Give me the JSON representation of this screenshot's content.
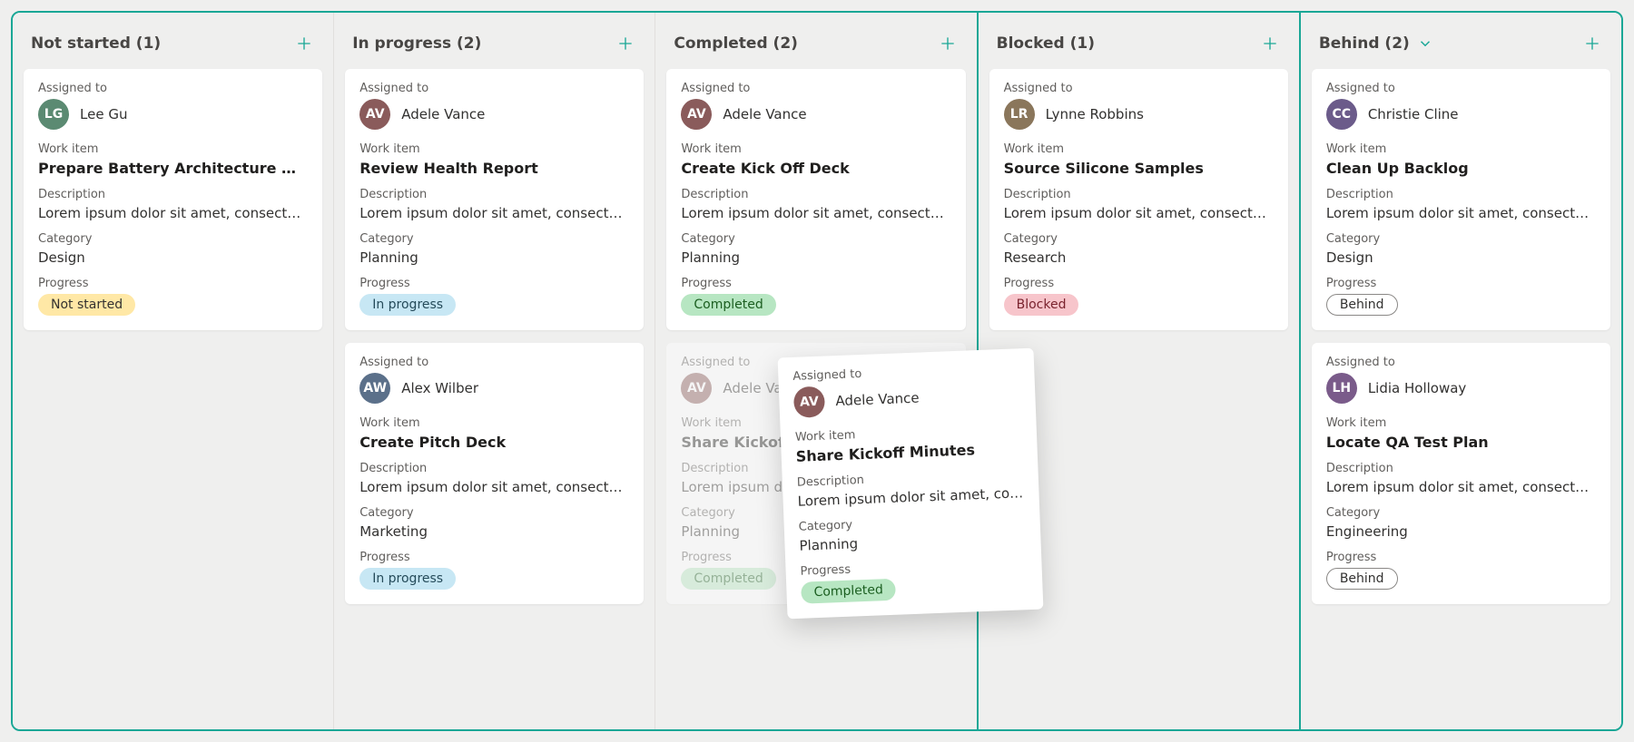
{
  "labels": {
    "assigned_to": "Assigned to",
    "work_item": "Work item",
    "description": "Description",
    "category": "Category",
    "progress": "Progress"
  },
  "columns": [
    {
      "title": "Not started (1)",
      "accent_divider": false,
      "show_chevron": false,
      "cards": [
        {
          "assignee": "Lee Gu",
          "assignee_initials": "LG",
          "avatar_class": "av-a",
          "work_item": "Prepare Battery Architecture Diag…",
          "description": "Lorem ipsum dolor sit amet, consecte…",
          "category": "Design",
          "progress_label": "Not started",
          "chip_class": "chip-notstarted",
          "ghost": false
        }
      ]
    },
    {
      "title": "In progress (2)",
      "accent_divider": false,
      "show_chevron": false,
      "cards": [
        {
          "assignee": "Adele Vance",
          "assignee_initials": "AV",
          "avatar_class": "av-b",
          "work_item": "Review Health Report",
          "description": "Lorem ipsum dolor sit amet, consecte…",
          "category": "Planning",
          "progress_label": "In progress",
          "chip_class": "chip-inprogress",
          "ghost": false
        },
        {
          "assignee": "Alex Wilber",
          "assignee_initials": "AW",
          "avatar_class": "av-e",
          "work_item": "Create Pitch Deck",
          "description": "Lorem ipsum dolor sit amet, consecte…",
          "category": "Marketing",
          "progress_label": "In progress",
          "chip_class": "chip-inprogress",
          "ghost": false
        }
      ]
    },
    {
      "title": "Completed (2)",
      "accent_divider": true,
      "show_chevron": false,
      "cards": [
        {
          "assignee": "Adele Vance",
          "assignee_initials": "AV",
          "avatar_class": "av-b",
          "work_item": "Create Kick Off Deck",
          "description": "Lorem ipsum dolor sit amet, consecte…",
          "category": "Planning",
          "progress_label": "Completed",
          "chip_class": "chip-completed",
          "ghost": false
        },
        {
          "assignee": "Adele Vance",
          "assignee_initials": "AV",
          "avatar_class": "av-b",
          "work_item": "Share Kickoff Minutes",
          "description": "Lorem ipsum dolor sit amet, consecte…",
          "category": "Planning",
          "progress_label": "Completed",
          "chip_class": "chip-completed",
          "ghost": true
        }
      ]
    },
    {
      "title": "Blocked (1)",
      "accent_divider": true,
      "show_chevron": false,
      "cards": [
        {
          "assignee": "Lynne Robbins",
          "assignee_initials": "LR",
          "avatar_class": "av-d",
          "work_item": "Source Silicone Samples",
          "description": "Lorem ipsum dolor sit amet, consecte…",
          "category": "Research",
          "progress_label": "Blocked",
          "chip_class": "chip-blocked",
          "ghost": false
        }
      ]
    },
    {
      "title": "Behind (2)",
      "accent_divider": false,
      "show_chevron": true,
      "cards": [
        {
          "assignee": "Christie Cline",
          "assignee_initials": "CC",
          "avatar_class": "av-c",
          "work_item": "Clean Up Backlog",
          "description": "Lorem ipsum dolor sit amet, consecte…",
          "category": "Design",
          "progress_label": "Behind",
          "chip_class": "chip-behind",
          "ghost": false
        },
        {
          "assignee": "Lidia Holloway",
          "assignee_initials": "LH",
          "avatar_class": "av-f",
          "work_item": "Locate QA Test Plan",
          "description": "Lorem ipsum dolor sit amet, consecte…",
          "category": "Engineering",
          "progress_label": "Behind",
          "chip_class": "chip-behind",
          "ghost": false
        }
      ]
    }
  ],
  "drag_card": {
    "assignee": "Adele Vance",
    "assignee_initials": "AV",
    "avatar_class": "av-b",
    "work_item": "Share Kickoff Minutes",
    "description": "Lorem ipsum dolor sit amet, consectet…",
    "category": "Planning",
    "progress_label": "Completed",
    "chip_class": "chip-completed"
  }
}
